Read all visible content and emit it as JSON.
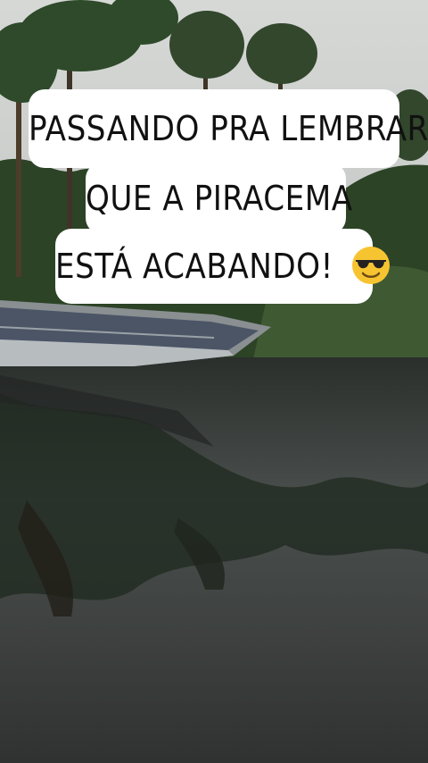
{
  "caption": {
    "line1": "PASSANDO PRA LEMBRAR",
    "line2": "QUE A PIRACEMA",
    "line3": "ESTÁ ACABANDO!",
    "emoji": "smiling-face-with-sunglasses-icon"
  },
  "colors": {
    "sky": "#c9ccc9",
    "vegetation": "#2f4a2a",
    "water": "#3a3c3b",
    "caption_bg": "#ffffff",
    "caption_text": "#111111",
    "emoji_yellow": "#f7c431"
  }
}
